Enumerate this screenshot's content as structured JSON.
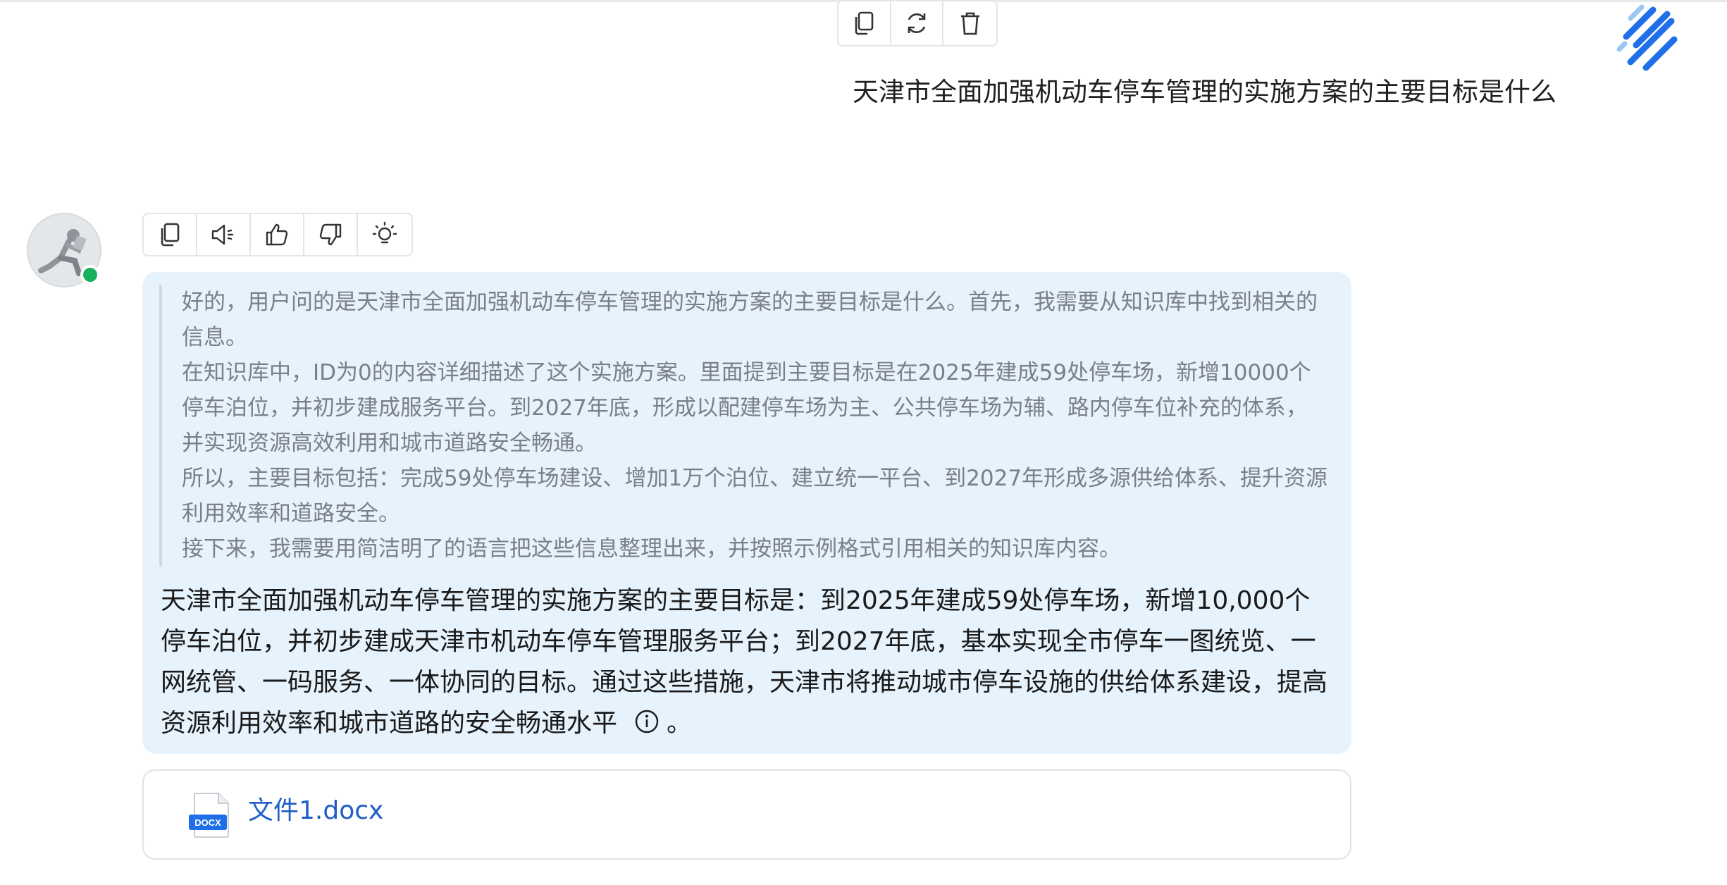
{
  "user_toolbar": {
    "buttons": [
      {
        "icon": "copy-icon"
      },
      {
        "icon": "refresh-icon"
      },
      {
        "icon": "trash-icon"
      }
    ]
  },
  "user_message": {
    "text": "天津市全面加强机动车停车管理的实施方案的主要目标是什么"
  },
  "bot_toolbar": {
    "buttons": [
      {
        "icon": "copy-icon"
      },
      {
        "icon": "speaker-icon"
      },
      {
        "icon": "thumbs-up-icon"
      },
      {
        "icon": "thumbs-down-icon"
      },
      {
        "icon": "lightbulb-icon"
      }
    ]
  },
  "bot_status": {
    "color": "#1aaf5d"
  },
  "thinking": {
    "paragraphs": [
      "好的，用户问的是天津市全面加强机动车停车管理的实施方案的主要目标是什么。首先，我需要从知识库中找到相关的信息。",
      "在知识库中，ID为0的内容详细描述了这个实施方案。里面提到主要目标是在2025年建成59处停车场，新增10000个停车泊位，并初步建成服务平台。到2027年底，形成以配建停车场为主、公共停车场为辅、路内停车位补充的体系，并实现资源高效利用和城市道路安全畅通。",
      "所以，主要目标包括：完成59处停车场建设、增加1万个泊位、建立统一平台、到2027年形成多源供给体系、提升资源利用效率和道路安全。",
      "接下来，我需要用简洁明了的语言把这些信息整理出来，并按照示例格式引用相关的知识库内容。"
    ]
  },
  "answer": {
    "text": "天津市全面加强机动车停车管理的实施方案的主要目标是：到2025年建成59处停车场，新增10,000个停车泊位，并初步建成天津市机动车停车管理服务平台；到2027年底，基本实现全市停车一图统览、一网统管、一码服务、一体协同的目标。通过这些措施，天津市将推动城市停车设施的供给体系建设，提高资源利用效率和城市道路的安全畅通水平",
    "end_punct": "。"
  },
  "file": {
    "name": "文件1.docx",
    "badge": "DOCX"
  },
  "colors": {
    "bubble_bg": "#e6f2fc",
    "link": "#1e5ec4",
    "accent_blue": "#1e6fe8"
  }
}
